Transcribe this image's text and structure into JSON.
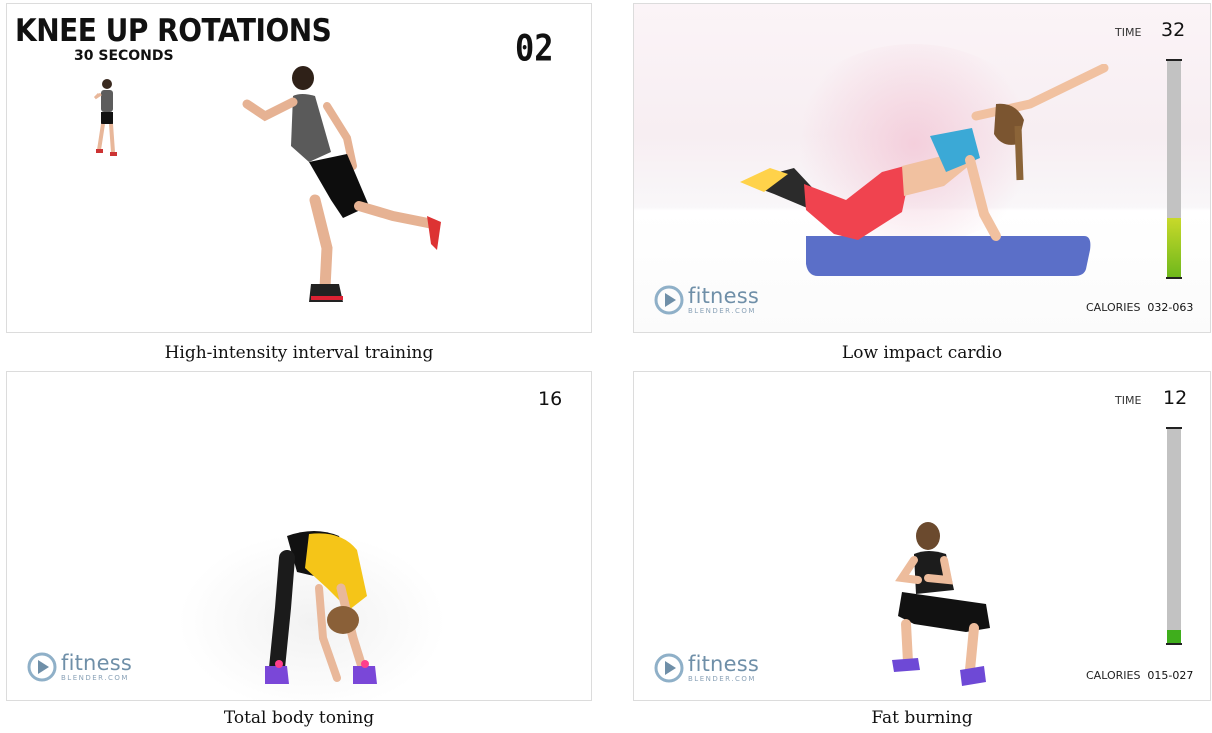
{
  "videos": [
    {
      "caption": "High-intensity interval training",
      "exercise_title": "KNEE UP ROTATIONS",
      "exercise_duration": "30 SECONDS",
      "counter": "02"
    },
    {
      "caption": "Low impact cardio",
      "time_label": "TIME",
      "time_value": "32",
      "calories_label": "CALORIES",
      "calories_value": "032-063",
      "meter_fill_fraction": 0.27,
      "logo_main": "fitness",
      "logo_sub": "BLENDER.COM"
    },
    {
      "caption": "Total body toning",
      "counter": "16",
      "logo_main": "fitness",
      "logo_sub": "BLENDER.COM"
    },
    {
      "caption": "Fat burning",
      "time_label": "TIME",
      "time_value": "12",
      "calories_label": "CALORIES",
      "calories_value": "015-027",
      "meter_fill_fraction": 0.06,
      "logo_main": "fitness",
      "logo_sub": "BLENDER.COM"
    }
  ],
  "colors": {
    "meter_track": "#c2c2c2",
    "meter_fill_green": "#7cc21a",
    "meter_fill_dark_green": "#3fae1c",
    "logo": "#6f8fa8"
  },
  "icons": [
    "play-logo-icon"
  ]
}
